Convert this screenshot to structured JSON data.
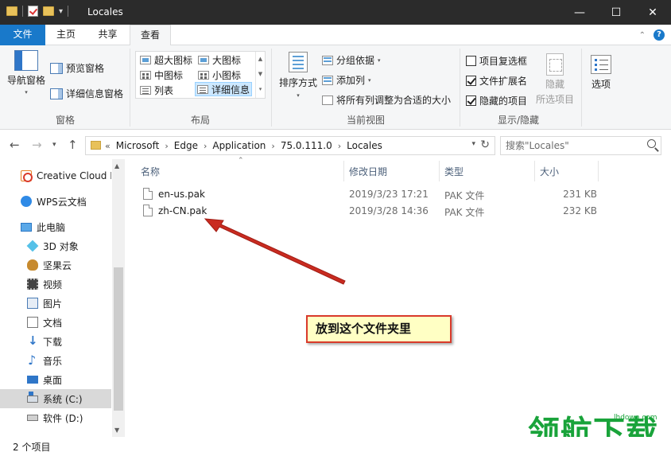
{
  "window": {
    "title": "Locales",
    "buttons": {
      "minimize": "—",
      "maximize": "☐",
      "close": "✕"
    }
  },
  "tabs": [
    {
      "label": "文件"
    },
    {
      "label": "主页"
    },
    {
      "label": "共享"
    },
    {
      "label": "查看"
    }
  ],
  "ribbon": {
    "panes": {
      "nav_pane": "导航窗格",
      "preview_pane": "预览窗格",
      "details_pane": "详细信息窗格",
      "group_label": "窗格"
    },
    "layout": {
      "items": [
        "超大图标",
        "大图标",
        "中图标",
        "小图标",
        "列表",
        "详细信息"
      ],
      "selected": "详细信息",
      "group_label": "布局"
    },
    "current_view": {
      "sort_by": "排序方式",
      "group_by": "分组依据",
      "add_column": "添加列",
      "fit_columns": "将所有列调整为合适的大小",
      "group_label": "当前视图"
    },
    "show_hide": {
      "item_checkboxes": {
        "label": "项目复选框",
        "checked": false
      },
      "file_extensions": {
        "label": "文件扩展名",
        "checked": true
      },
      "hidden_items": {
        "label": "隐藏的项目",
        "checked": true
      },
      "hide_selected": "隐藏\n所选项目",
      "hide_selected_l1": "隐藏",
      "hide_selected_l2": "所选项目",
      "group_label": "显示/隐藏"
    },
    "options": "选项"
  },
  "address": {
    "overflow": "«",
    "breadcrumbs": [
      "Microsoft",
      "Edge",
      "Application",
      "75.0.111.0",
      "Locales"
    ],
    "search_placeholder": "搜索\"Locales\""
  },
  "nav": {
    "items": [
      {
        "label": "Creative Cloud Files",
        "icon": "creative-cloud-icon"
      },
      {
        "label": "WPS云文档",
        "icon": "wps-cloud-icon"
      },
      {
        "label": "此电脑",
        "icon": "this-pc-icon"
      },
      {
        "label": "3D 对象",
        "icon": "3d-objects-icon"
      },
      {
        "label": "坚果云",
        "icon": "nutstore-icon"
      },
      {
        "label": "视频",
        "icon": "videos-icon"
      },
      {
        "label": "图片",
        "icon": "pictures-icon"
      },
      {
        "label": "文档",
        "icon": "documents-icon"
      },
      {
        "label": "下载",
        "icon": "downloads-icon"
      },
      {
        "label": "音乐",
        "icon": "music-icon"
      },
      {
        "label": "桌面",
        "icon": "desktop-icon"
      },
      {
        "label": "系统 (C:)",
        "icon": "drive-c-icon",
        "selected": true
      },
      {
        "label": "软件 (D:)",
        "icon": "drive-d-icon"
      }
    ]
  },
  "files": {
    "columns": [
      "名称",
      "修改日期",
      "类型",
      "大小"
    ],
    "rows": [
      {
        "name": "en-us.pak",
        "date": "2019/3/23 17:21",
        "type": "PAK 文件",
        "size": "231 KB"
      },
      {
        "name": "zh-CN.pak",
        "date": "2019/3/28 14:36",
        "type": "PAK 文件",
        "size": "232 KB"
      }
    ]
  },
  "annotation": {
    "text": "放到这个文件夹里",
    "color": "#d93a2b"
  },
  "status": {
    "count": "2 个项目"
  },
  "watermark": {
    "text": "领航下载",
    "url": "lhdown.com",
    "color": "#19a33a"
  },
  "colors": {
    "accent": "#1979ca",
    "titlebar": "#2b2b2b",
    "selection": "#cce8ff"
  }
}
